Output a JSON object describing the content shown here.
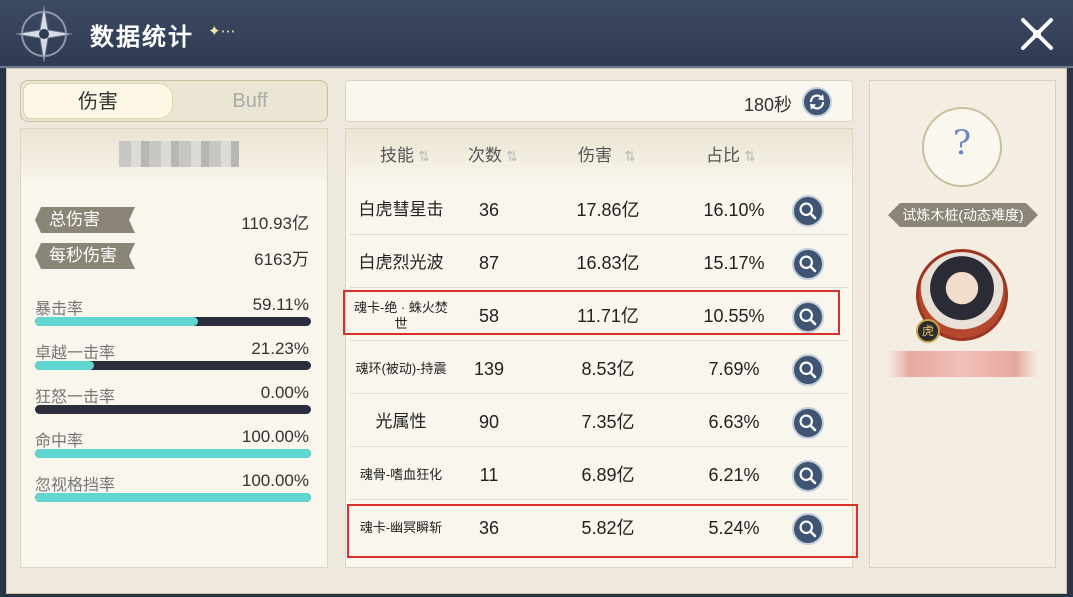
{
  "header": {
    "title": "数据统计",
    "deco": "✦⋯"
  },
  "tabs": [
    {
      "label": "伤害",
      "active": true
    },
    {
      "label": "Buff",
      "active": false
    }
  ],
  "summary": {
    "total_damage_label": "总伤害",
    "total_damage_value": "110.93亿",
    "dps_label": "每秒伤害",
    "dps_value": "6163万"
  },
  "rates": [
    {
      "label": "暴击率",
      "value": "59.11%",
      "fraction": 0.5911
    },
    {
      "label": "卓越一击率",
      "value": "21.23%",
      "fraction": 0.2123
    },
    {
      "label": "狂怒一击率",
      "value": "0.00%",
      "fraction": 0.0
    },
    {
      "label": "命中率",
      "value": "100.00%",
      "fraction": 1.0
    },
    {
      "label": "忽视格挡率",
      "value": "100.00%",
      "fraction": 1.0
    }
  ],
  "timer": {
    "text": "180秒"
  },
  "table": {
    "headers": {
      "skill": "技能",
      "count": "次数",
      "damage": "伤害",
      "share": "占比"
    },
    "sort_icon": "⇅",
    "rows": [
      {
        "skill": "白虎彗星击",
        "count": "36",
        "damage": "17.86亿",
        "share": "16.10%"
      },
      {
        "skill": "白虎烈光波",
        "count": "87",
        "damage": "16.83亿",
        "share": "15.17%"
      },
      {
        "skill": "魂卡-绝 · 蛛火焚世",
        "count": "58",
        "damage": "11.71亿",
        "share": "10.55%"
      },
      {
        "skill": "魂环(被动)-持震",
        "count": "139",
        "damage": "8.53亿",
        "share": "7.69%"
      },
      {
        "skill": "光属性",
        "count": "90",
        "damage": "7.35亿",
        "share": "6.63%"
      },
      {
        "skill": "魂骨-嗜血狂化",
        "count": "11",
        "damage": "6.89亿",
        "share": "6.21%"
      },
      {
        "skill": "魂卡-幽冥瞬斩",
        "count": "36",
        "damage": "5.82亿",
        "share": "5.24%"
      }
    ]
  },
  "target": {
    "icon": "?",
    "name": "试炼木桩(动态难度)"
  },
  "colors": {
    "bar_fill": "#5fd6cf",
    "bar_bg": "#2b2d3b",
    "highlight": "#d9302a",
    "button": "#3f5573"
  }
}
